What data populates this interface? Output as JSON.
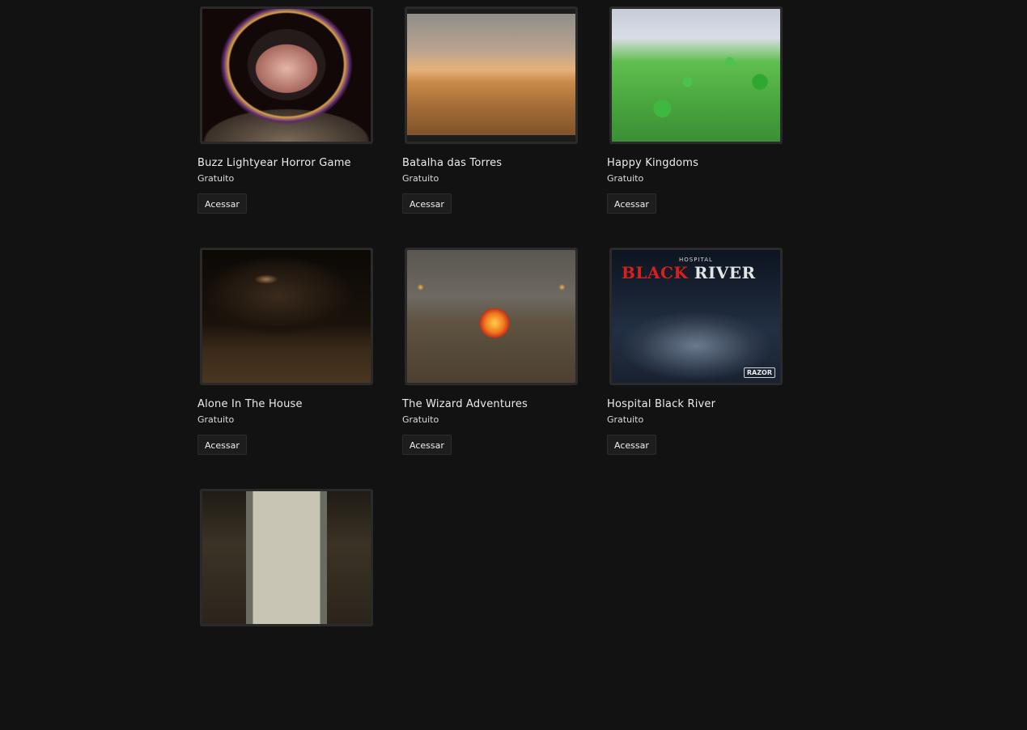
{
  "games": [
    {
      "title": "Buzz Lightyear Horror Game",
      "price": "Gratuito",
      "action": "Acessar",
      "thumb_icon": "buzz-lightyear-thumbnail"
    },
    {
      "title": "Batalha das Torres",
      "price": "Gratuito",
      "action": "Acessar",
      "thumb_icon": "tower-cannon-thumbnail"
    },
    {
      "title": "Happy Kingdoms",
      "price": "Gratuito",
      "action": "Acessar",
      "thumb_icon": "low-poly-kingdom-thumbnail"
    },
    {
      "title": "Alone In The House",
      "price": "Gratuito",
      "action": "Acessar",
      "thumb_icon": "dark-room-thumbnail"
    },
    {
      "title": "The Wizard Adventures",
      "price": "Gratuito",
      "action": "Acessar",
      "thumb_icon": "wizard-fire-thumbnail"
    },
    {
      "title": "Hospital Black River",
      "price": "Gratuito",
      "action": "Acessar",
      "thumb_icon": "hospital-ward-thumbnail",
      "thumb_text": {
        "small": "HOSPITAL",
        "big_red": "BLACK",
        "big_white": "RIVER",
        "badge": "RAZOR"
      }
    },
    {
      "title": "",
      "price": "",
      "action": "",
      "thumb_icon": "dark-corridor-thumbnail"
    }
  ],
  "colors": {
    "background": "#121212",
    "button_bg": "#1d1d1d",
    "text": "#ececec"
  }
}
